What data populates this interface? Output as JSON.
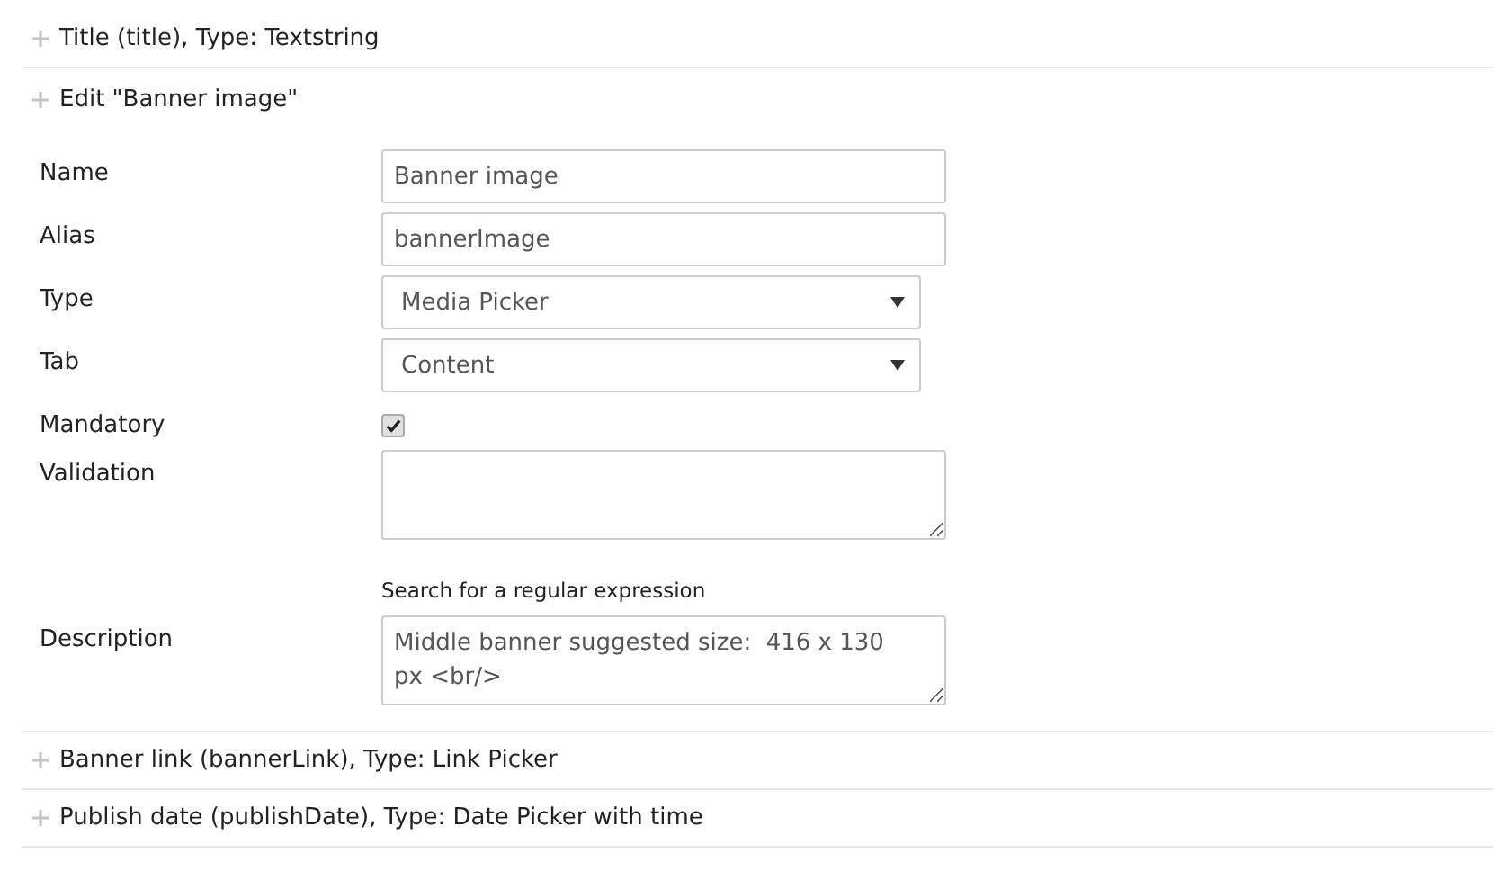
{
  "properties": [
    {
      "label": "Title (title), Type: Textstring",
      "expanded": false
    },
    {
      "label": "Edit \"Banner image\"",
      "expanded": true,
      "fields": [
        {
          "kind": "text",
          "label": "Name",
          "value": "Banner image"
        },
        {
          "kind": "text",
          "label": "Alias",
          "value": "bannerImage"
        },
        {
          "kind": "select",
          "label": "Type",
          "value": "Media Picker"
        },
        {
          "kind": "select",
          "label": "Tab",
          "value": "Content"
        },
        {
          "kind": "checkbox",
          "label": "Mandatory",
          "checked": true
        },
        {
          "kind": "textarea",
          "label": "Validation",
          "hint": "Search for a regular expression"
        },
        {
          "kind": "textarea",
          "label": "Description",
          "value": "Middle banner suggested size:  416 x 130 px <br/>"
        }
      ]
    },
    {
      "label": "Banner link (bannerLink), Type: Link Picker",
      "expanded": false
    },
    {
      "label": "Publish date (publishDate), Type: Date Picker with time",
      "expanded": false
    }
  ]
}
